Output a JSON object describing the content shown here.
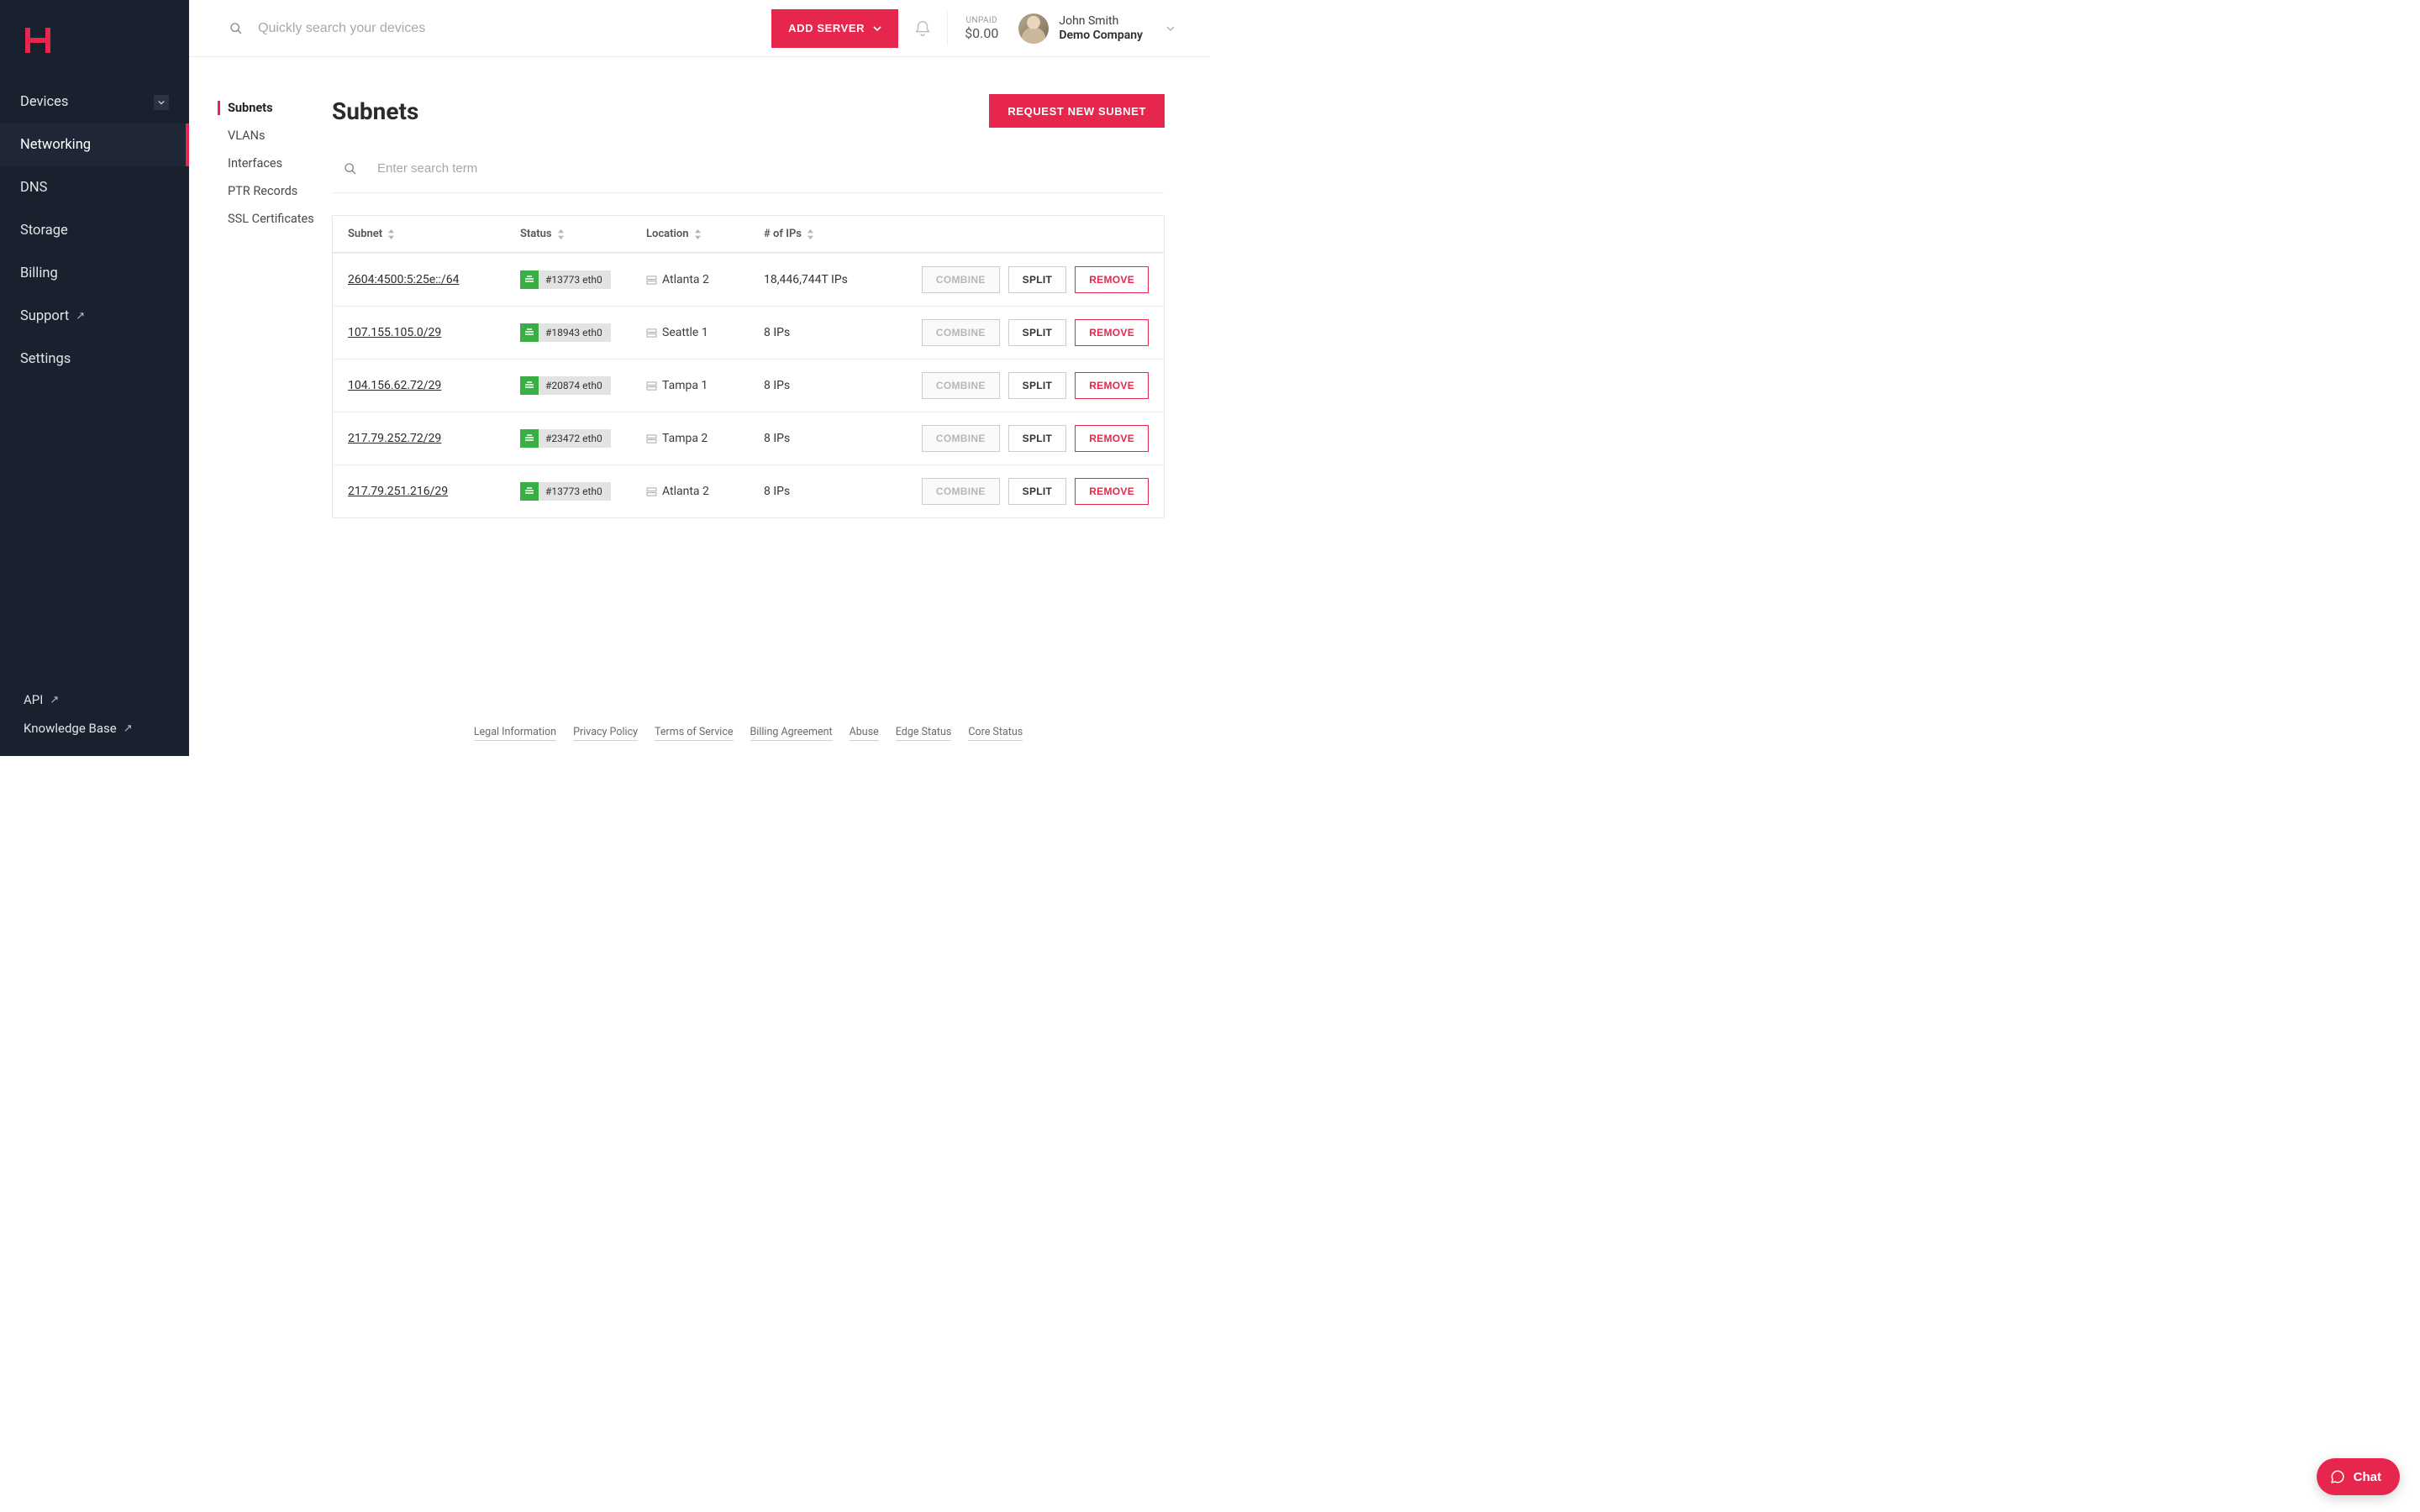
{
  "header": {
    "search_placeholder": "Quickly search your devices",
    "add_server_label": "ADD SERVER",
    "balance_label": "UNPAID",
    "balance_amount": "$0.00",
    "user_name": "John Smith",
    "user_company": "Demo Company"
  },
  "sidebar": {
    "items": [
      {
        "label": "Devices",
        "active": false
      },
      {
        "label": "Networking",
        "active": true
      },
      {
        "label": "DNS",
        "active": false
      },
      {
        "label": "Storage",
        "active": false
      },
      {
        "label": "Billing",
        "active": false
      },
      {
        "label": "Support",
        "active": false
      },
      {
        "label": "Settings",
        "active": false
      }
    ],
    "bottom": [
      {
        "label": "API"
      },
      {
        "label": "Knowledge Base"
      }
    ]
  },
  "subnav": {
    "items": [
      {
        "label": "Subnets",
        "active": true
      },
      {
        "label": "VLANs",
        "active": false
      },
      {
        "label": "Interfaces",
        "active": false
      },
      {
        "label": "PTR Records",
        "active": false
      },
      {
        "label": "SSL Certificates",
        "active": false
      }
    ]
  },
  "panel": {
    "title": "Subnets",
    "request_label": "REQUEST NEW SUBNET",
    "filter_placeholder": "Enter search term",
    "columns": {
      "subnet": "Subnet",
      "status": "Status",
      "location": "Location",
      "ips": "# of IPs"
    },
    "actions": {
      "combine": "COMBINE",
      "split": "SPLIT",
      "remove": "REMOVE"
    },
    "rows": [
      {
        "subnet": "2604:4500:5:25e::/64",
        "status": "#13773 eth0",
        "location": "Atlanta 2",
        "ips": "18,446,744T IPs"
      },
      {
        "subnet": "107.155.105.0/29",
        "status": "#18943 eth0",
        "location": "Seattle 1",
        "ips": "8 IPs"
      },
      {
        "subnet": "104.156.62.72/29",
        "status": "#20874 eth0",
        "location": "Tampa 1",
        "ips": "8 IPs"
      },
      {
        "subnet": "217.79.252.72/29",
        "status": "#23472 eth0",
        "location": "Tampa 2",
        "ips": "8 IPs"
      },
      {
        "subnet": "217.79.251.216/29",
        "status": "#13773 eth0",
        "location": "Atlanta 2",
        "ips": "8 IPs"
      }
    ]
  },
  "footer": {
    "links": [
      "Legal Information",
      "Privacy Policy",
      "Terms of Service",
      "Billing Agreement",
      "Abuse",
      "Edge Status",
      "Core Status"
    ]
  },
  "chat": {
    "label": "Chat"
  }
}
